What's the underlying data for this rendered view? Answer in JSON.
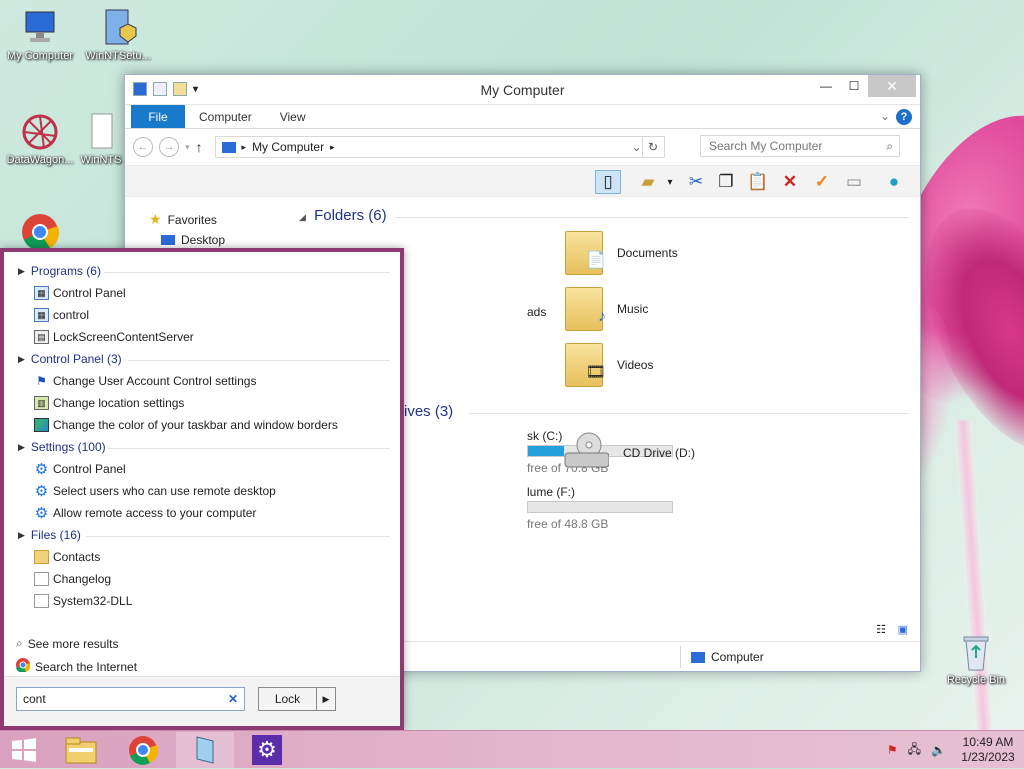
{
  "desktop": {
    "icons": [
      {
        "label": "My Computer"
      },
      {
        "label": "WinNTSetu..."
      },
      {
        "label": "DataWagon..."
      },
      {
        "label": "WinNTS"
      },
      {
        "label": "Recycle Bin"
      }
    ]
  },
  "explorer": {
    "title": "My Computer",
    "tabs": {
      "file": "File",
      "computer": "Computer",
      "view": "View"
    },
    "help": "?",
    "address": {
      "path": "My Computer"
    },
    "search": {
      "placeholder": "Search My Computer"
    },
    "nav": {
      "favorites": "Favorites",
      "desktop": "Desktop"
    },
    "folders_header": "Folders (6)",
    "folders": [
      {
        "label": "Documents"
      },
      {
        "label": "Music"
      },
      {
        "label": "Videos"
      },
      {
        "label": "ads"
      }
    ],
    "drives_header": "rives (3)",
    "drives": [
      {
        "label": "sk (C:)",
        "free": "free of 70.8 GB",
        "used_fraction": 0.25
      },
      {
        "label": "lume (F:)",
        "free": "free of 48.8 GB",
        "used_fraction": 0.0
      },
      {
        "label": "CD Drive (D:)"
      }
    ],
    "status": {
      "location": "Computer"
    }
  },
  "start_search": {
    "categories": [
      {
        "label": "Programs (6)",
        "items": [
          "Control Panel",
          "control",
          "LockScreenContentServer"
        ]
      },
      {
        "label": "Control Panel (3)",
        "items": [
          "Change User Account Control settings",
          "Change location settings",
          "Change the color of your taskbar and window borders"
        ]
      },
      {
        "label": "Settings (100)",
        "items": [
          "Control Panel",
          "Select users who can use remote desktop",
          "Allow remote access to your computer"
        ]
      },
      {
        "label": "Files (16)",
        "items": [
          "Contacts",
          "Changelog",
          "System32-DLL"
        ]
      }
    ],
    "see_more": "See more results",
    "search_internet": "Search the Internet",
    "query": "cont",
    "lock_label": "Lock"
  },
  "taskbar": {
    "time": "10:49 AM",
    "date": "1/23/2023"
  },
  "colors": {
    "accent": "#1979ca",
    "panel_border": "#8c3a6f",
    "taskbar": "#dca8c4"
  }
}
